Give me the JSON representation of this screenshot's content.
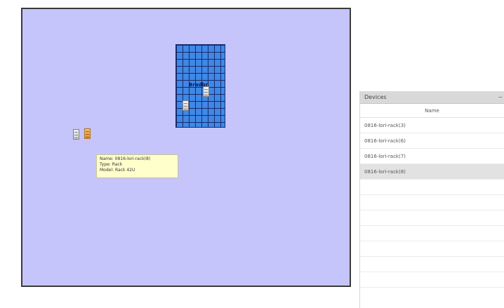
{
  "floor": {
    "zone": {
      "label": "Bradbr"
    },
    "tooltip": {
      "name_line": "Name: 0816-lori-rack(8)",
      "type_line": "Type: Rack",
      "model_line": "Model: Rack 42U"
    }
  },
  "panel": {
    "title": "Devices",
    "collapse_icon": "−",
    "column_name": "Name",
    "rows": [
      {
        "name": "0816-lori-rack(3)"
      },
      {
        "name": "0816-lori-rack(6)"
      },
      {
        "name": "0816-lori-rack(7)"
      },
      {
        "name": "0816-lori-rack(8)"
      }
    ],
    "selected_row": "0816-lori-rack(8)"
  },
  "colors": {
    "floor": "#c5c5fb",
    "zone": "#3f88e6",
    "highlight_rack": "#e0952a",
    "tooltip_bg": "#ffffcc"
  }
}
